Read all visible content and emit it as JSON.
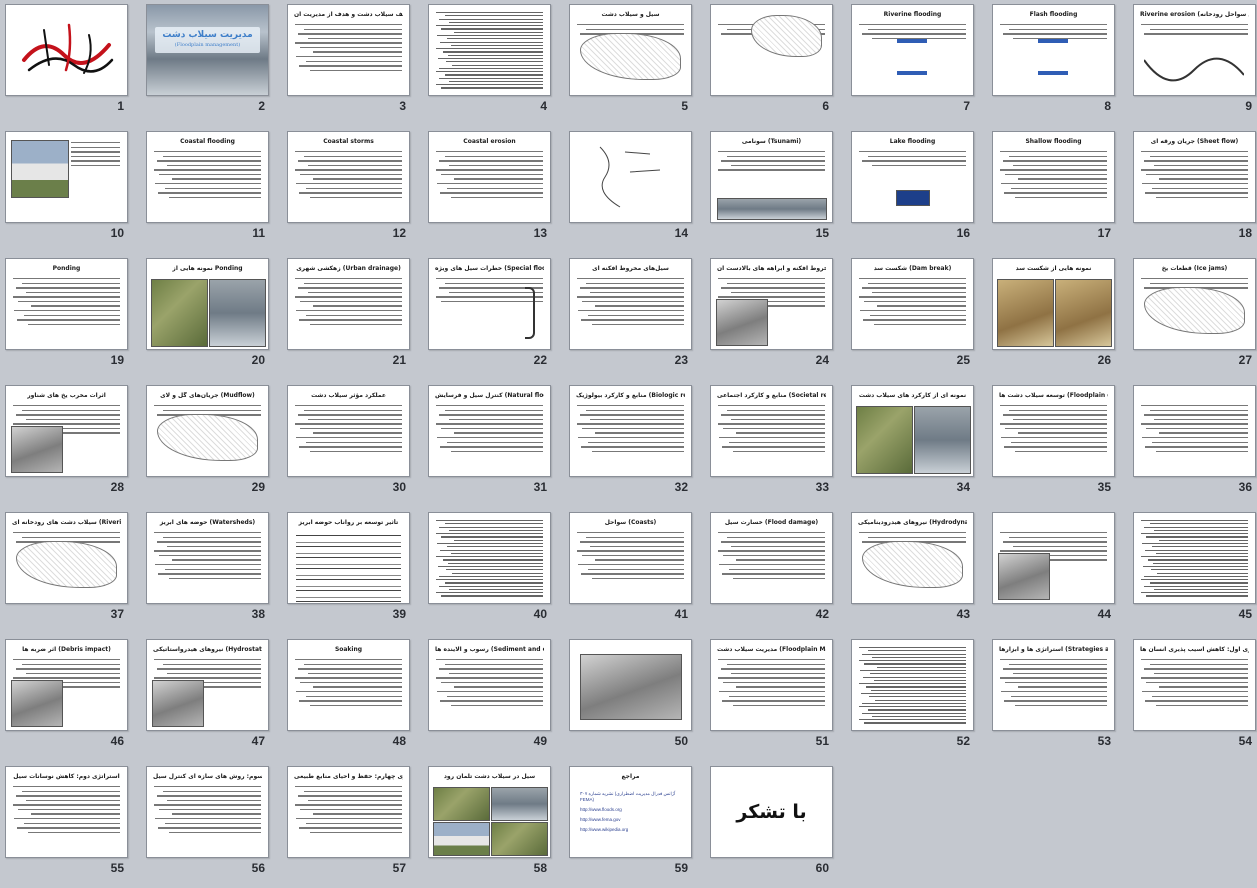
{
  "sorter": {
    "slides": [
      {
        "n": "1",
        "kind": "calligraphy",
        "title": ""
      },
      {
        "n": "2",
        "kind": "cover",
        "title": "مدیریت سیلاب دشت",
        "subtitle": "(Floodplain management)"
      },
      {
        "n": "3",
        "kind": "text",
        "title": "تعریف سیلاب دشت و هدف از مدیریت آن"
      },
      {
        "n": "4",
        "kind": "dense",
        "title": ""
      },
      {
        "n": "5",
        "kind": "diagram",
        "title": "سیل و سیلاب دشت"
      },
      {
        "n": "6",
        "kind": "diagram2",
        "title": ""
      },
      {
        "n": "7",
        "kind": "arrows",
        "title": "Riverine flooding"
      },
      {
        "n": "8",
        "kind": "arrows",
        "title": "Flash flooding"
      },
      {
        "n": "9",
        "kind": "river",
        "title": "Riverine erosion (فرسایش سواحل رودخانه)"
      },
      {
        "n": "10",
        "kind": "photo-house",
        "title": ""
      },
      {
        "n": "11",
        "kind": "text",
        "title": "Coastal flooding"
      },
      {
        "n": "12",
        "kind": "text",
        "title": "Coastal storms"
      },
      {
        "n": "13",
        "kind": "text",
        "title": "Coastal erosion"
      },
      {
        "n": "14",
        "kind": "map",
        "title": ""
      },
      {
        "n": "15",
        "kind": "tsunami",
        "title": "سونامی (Tsunami)"
      },
      {
        "n": "16",
        "kind": "fema",
        "title": "Lake flooding"
      },
      {
        "n": "17",
        "kind": "text",
        "title": "Shallow flooding"
      },
      {
        "n": "18",
        "kind": "text",
        "title": "جریان ورقه ای (Sheet flow)"
      },
      {
        "n": "19",
        "kind": "text",
        "title": "Ponding"
      },
      {
        "n": "20",
        "kind": "photo-two",
        "title": "نمونه هایی از Ponding"
      },
      {
        "n": "21",
        "kind": "text",
        "title": "زهکشی شهری (Urban drainage)"
      },
      {
        "n": "22",
        "kind": "bracket",
        "title": "خطرات سیل های ویژه (Special flood hazards)"
      },
      {
        "n": "23",
        "kind": "text",
        "title": "سیل‌های مخروط افکنه ای"
      },
      {
        "n": "24",
        "kind": "photo-left",
        "title": "نمایی از مخروط افکنه و آبراهه های بالادست آن"
      },
      {
        "n": "25",
        "kind": "text",
        "title": "شکست سد (Dam break)"
      },
      {
        "n": "26",
        "kind": "photo-two",
        "title": "نمونه هایی از شکست سد"
      },
      {
        "n": "27",
        "kind": "diagram",
        "title": "قطعات یخ (Ice jams)"
      },
      {
        "n": "28",
        "kind": "photo-left",
        "title": "اثرات مخرب یخ های شناور"
      },
      {
        "n": "29",
        "kind": "diagram",
        "title": "جریان‌های گل و لای (Mudflow)"
      },
      {
        "n": "30",
        "kind": "text",
        "title": "عملکرد مؤثر سیلاب دشت"
      },
      {
        "n": "31",
        "kind": "text",
        "title": "کنترل سیل و فرسایش (Natural flood and erosion control)"
      },
      {
        "n": "32",
        "kind": "text",
        "title": "منابع و کارکرد بیولوژیک (Biologic resources and functions)"
      },
      {
        "n": "33",
        "kind": "text",
        "title": "منابع و کارکرد اجتماعی (Societal resources and functions)"
      },
      {
        "n": "34",
        "kind": "photo-two",
        "title": "نمونه ای از کارکرد های سیلاب دشت"
      },
      {
        "n": "35",
        "kind": "text",
        "title": "توسعه سیلاب دشت ها (Floodplain development)"
      },
      {
        "n": "36",
        "kind": "text",
        "title": ""
      },
      {
        "n": "37",
        "kind": "diagram",
        "title": "سیلاب دشت های رودخانه ای (Riverine floodplains)"
      },
      {
        "n": "38",
        "kind": "text",
        "title": "حوضه های آبریز (Watersheds)"
      },
      {
        "n": "39",
        "kind": "stack",
        "title": "تأثیر توسعه بر رواناب حوضه آبریز"
      },
      {
        "n": "40",
        "kind": "dense",
        "title": ""
      },
      {
        "n": "41",
        "kind": "text",
        "title": "سواحل (Coasts)"
      },
      {
        "n": "42",
        "kind": "text",
        "title": "خسارت سیل (Flood damage)"
      },
      {
        "n": "43",
        "kind": "diagram",
        "title": "نیروهای هیدرودینامیکی (Hydrodynamic forces)"
      },
      {
        "n": "44",
        "kind": "photo-left",
        "title": ""
      },
      {
        "n": "45",
        "kind": "dense",
        "title": ""
      },
      {
        "n": "46",
        "kind": "photo-left",
        "title": "اثر ضربه ها (Debris impact)"
      },
      {
        "n": "47",
        "kind": "photo-left",
        "title": "نیروهای هیدرواستاتیکی (Hydrostatic forces)"
      },
      {
        "n": "48",
        "kind": "text",
        "title": "Soaking"
      },
      {
        "n": "49",
        "kind": "text",
        "title": "رسوب و آلاینده ها (Sediment and contaminants)"
      },
      {
        "n": "50",
        "kind": "photo-full",
        "title": ""
      },
      {
        "n": "51",
        "kind": "text",
        "title": "مدیریت سیلاب دشت (Floodplain Management)"
      },
      {
        "n": "52",
        "kind": "dense",
        "title": ""
      },
      {
        "n": "53",
        "kind": "text",
        "title": "استراتژی ها و ابزارها (Strategies and tools)"
      },
      {
        "n": "54",
        "kind": "text",
        "title": "استراتژی اول: کاهش آسیب پذیری انسان ها"
      },
      {
        "n": "55",
        "kind": "text",
        "title": "استراتژی دوم: کاهش نوسانات سیل"
      },
      {
        "n": "56",
        "kind": "text",
        "title": "استراتژی سوم: روش های سازه ای کنترل سیل"
      },
      {
        "n": "57",
        "kind": "text",
        "title": "استراتژی چهارم: حفظ و احیای منابع طبیعی"
      },
      {
        "n": "58",
        "kind": "photo-four",
        "title": "سیل در سیلاب دشت تلمان رود"
      },
      {
        "n": "59",
        "kind": "refs",
        "title": "مراجع",
        "refs": [
          "نشریه شماره ۳۰۷ (آژانس فدرال مدیریت اضطراری FEMA)",
          "http://www.floods.org",
          "http://www.fema.gov",
          "http://www.wikipedia.org"
        ]
      },
      {
        "n": "60",
        "kind": "thanks",
        "title": "با تشکر"
      }
    ]
  },
  "colors": {
    "background": "#c4c8cf",
    "slide": "#ffffff",
    "accent": "#3d7ec9",
    "arrow": "#2f5db5"
  }
}
